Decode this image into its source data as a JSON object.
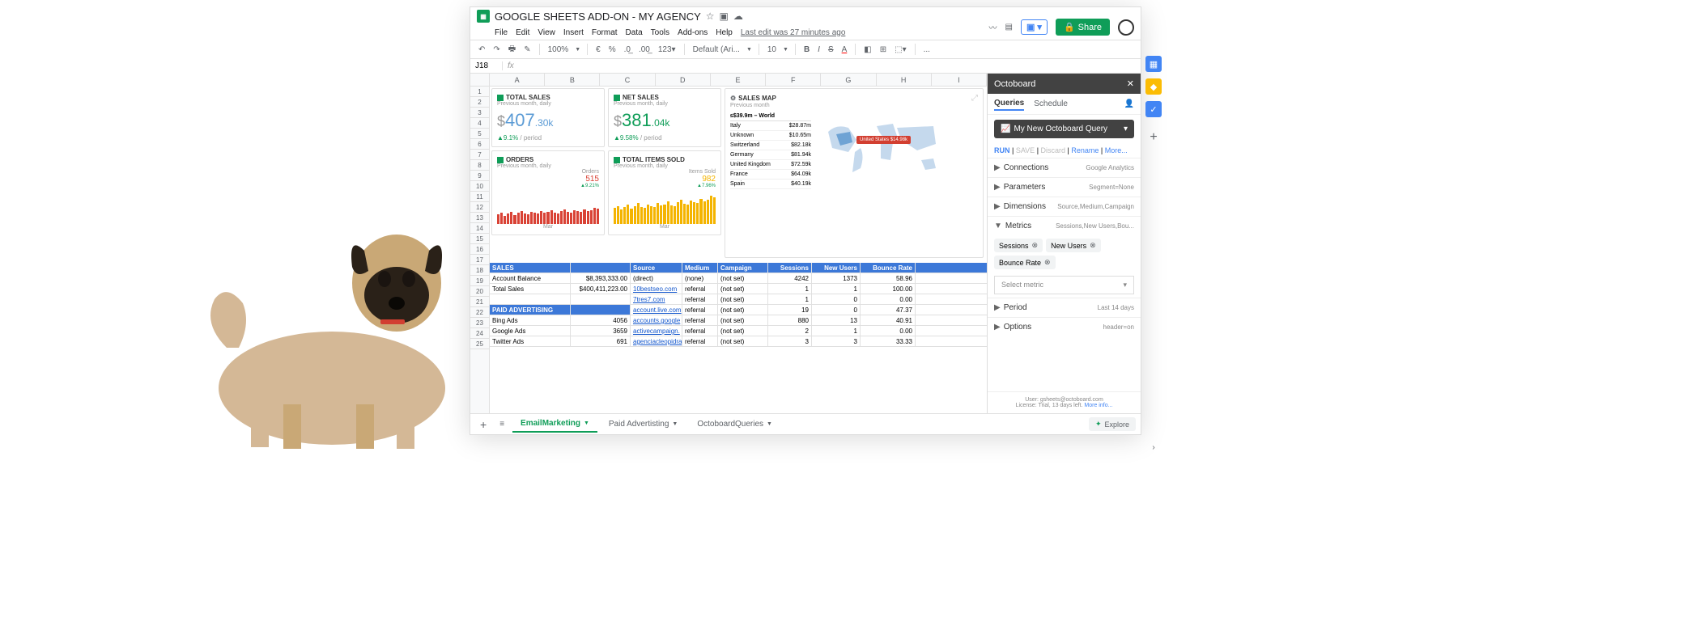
{
  "title": "GOOGLE SHEETS ADD-ON - MY AGENCY",
  "menu": [
    "File",
    "Edit",
    "View",
    "Insert",
    "Format",
    "Data",
    "Tools",
    "Add-ons",
    "Help"
  ],
  "lastedit": "Last edit was 27 minutes ago",
  "toolbar": {
    "zoom": "100%",
    "font": "Default (Ari...",
    "size": "10",
    "more": "..."
  },
  "share": "Share",
  "cellref": "J18",
  "cols": [
    "A",
    "B",
    "C",
    "D",
    "E",
    "F",
    "G",
    "H",
    "I"
  ],
  "dash": {
    "totalSales": {
      "title": "TOTAL SALES",
      "sub": "Previous month, daily",
      "curr": "$",
      "num": "407",
      "dec": ".30k",
      "trend": "▲9.1%",
      "per": "/ period"
    },
    "netSales": {
      "title": "NET SALES",
      "sub": "Previous month, daily",
      "curr": "$",
      "num": "381",
      "dec": ".04k",
      "trend": "▲9.58%",
      "per": "/ period"
    },
    "orders": {
      "title": "ORDERS",
      "sub": "Previous month, daily",
      "lbl": "Orders",
      "val": "515",
      "sparksub": "▲9.21%",
      "month": "Mar"
    },
    "items": {
      "title": "TOTAL ITEMS SOLD",
      "sub": "Previous month, daily",
      "lbl": "Items Sold",
      "val": "982",
      "sparksub": "▲7.96%",
      "month": "Mar"
    },
    "map": {
      "title": "SALES MAP",
      "sub": "Previous month",
      "total": "≤$39.9m – World",
      "rows": [
        {
          "c": "Italy",
          "v": "$28.87m"
        },
        {
          "c": "Unknown",
          "v": "$10.65m"
        },
        {
          "c": "Switzerland",
          "v": "$82.18k"
        },
        {
          "c": "Germany",
          "v": "$81.94k"
        },
        {
          "c": "United Kingdom",
          "v": "$72.59k"
        },
        {
          "c": "France",
          "v": "$64.09k"
        },
        {
          "c": "Spain",
          "v": "$40.19k"
        }
      ],
      "tooltip": "United States $14.98k"
    }
  },
  "grid": {
    "hdrs": [
      "Source",
      "Medium",
      "Campaign",
      "Sessions",
      "New Users",
      "Bounce Rate"
    ],
    "left": [
      {
        "section": "SALES"
      },
      {
        "l": "Account Balance",
        "v": "$8,393,333.00"
      },
      {
        "l": "Total Sales",
        "v": "$400,411,223.00"
      },
      {
        "blank": true
      },
      {
        "section": "PAID ADVERTISING"
      },
      {
        "l": "Bing Ads",
        "v": "4056"
      },
      {
        "l": "Google Ads",
        "v": "3659"
      },
      {
        "l": "Twitter Ads",
        "v": "691"
      }
    ],
    "right": [
      {
        "s": "(direct)",
        "m": "(none)",
        "c": "(not set)",
        "se": "4242",
        "nu": "1373",
        "br": "58.96"
      },
      {
        "s": "10bestseo.com",
        "m": "referral",
        "c": "(not set)",
        "se": "1",
        "nu": "1",
        "br": "100.00",
        "link": true
      },
      {
        "s": "7tres7.com",
        "m": "referral",
        "c": "(not set)",
        "se": "1",
        "nu": "0",
        "br": "0.00",
        "link": true
      },
      {
        "s": "account.live.com",
        "m": "referral",
        "c": "(not set)",
        "se": "19",
        "nu": "0",
        "br": "47.37",
        "link": true
      },
      {
        "s": "accounts.google",
        "m": "referral",
        "c": "(not set)",
        "se": "880",
        "nu": "13",
        "br": "40.91",
        "link": true
      },
      {
        "s": "activecampaign.",
        "m": "referral",
        "c": "(not set)",
        "se": "2",
        "nu": "1",
        "br": "0.00",
        "link": true
      },
      {
        "s": "agenciacleopidra",
        "m": "referral",
        "c": "(not set)",
        "se": "3",
        "nu": "3",
        "br": "33.33",
        "link": true
      }
    ],
    "rownums": [
      18,
      19,
      20,
      21,
      22,
      23,
      24,
      25
    ]
  },
  "sidebar": {
    "title": "Octoboard",
    "tabs": [
      "Queries",
      "Schedule"
    ],
    "query": "My New Octoboard Query",
    "actions": {
      "run": "RUN",
      "save": "SAVE",
      "discard": "Discard",
      "rename": "Rename",
      "more": "More..."
    },
    "sections": [
      {
        "l": "Connections",
        "v": "Google Analytics",
        "arr": "▶"
      },
      {
        "l": "Parameters",
        "v": "Segment=None",
        "arr": "▶"
      },
      {
        "l": "Dimensions",
        "v": "Source,Medium,Campaign",
        "arr": "▶"
      },
      {
        "l": "Metrics",
        "v": "Sessions,New Users,Bou...",
        "arr": "▼"
      }
    ],
    "chips": [
      "Sessions",
      "New Users",
      "Bounce Rate"
    ],
    "selectmetric": "Select metric",
    "period": {
      "l": "Period",
      "v": "Last 14 days"
    },
    "options": {
      "l": "Options",
      "v": "header=on"
    },
    "foot": {
      "user": "User: gsheets@octoboard.com",
      "license": "License: Trial, 13 days left.",
      "more": "More info..."
    }
  },
  "tabs": [
    {
      "l": "EmailMarketing",
      "active": true
    },
    {
      "l": "Paid Advertisting"
    },
    {
      "l": "OctoboardQueries"
    }
  ],
  "explore": "Explore",
  "chart_data": [
    {
      "type": "bar",
      "title": "ORDERS",
      "categories": [
        "Mar"
      ],
      "values": [
        515
      ],
      "spark_heights": [
        12,
        14,
        10,
        13,
        15,
        11,
        14,
        16,
        13,
        12,
        15,
        14,
        13,
        16,
        14,
        15,
        17,
        14,
        13,
        16,
        18,
        15,
        14,
        17,
        16,
        15,
        18,
        16,
        17,
        20,
        19
      ]
    },
    {
      "type": "bar",
      "title": "TOTAL ITEMS SOLD",
      "categories": [
        "Mar"
      ],
      "values": [
        982
      ],
      "spark_heights": [
        20,
        22,
        18,
        21,
        24,
        19,
        22,
        26,
        21,
        20,
        24,
        22,
        21,
        26,
        23,
        24,
        28,
        23,
        22,
        27,
        30,
        25,
        24,
        29,
        27,
        26,
        31,
        28,
        30,
        35,
        33
      ]
    }
  ]
}
